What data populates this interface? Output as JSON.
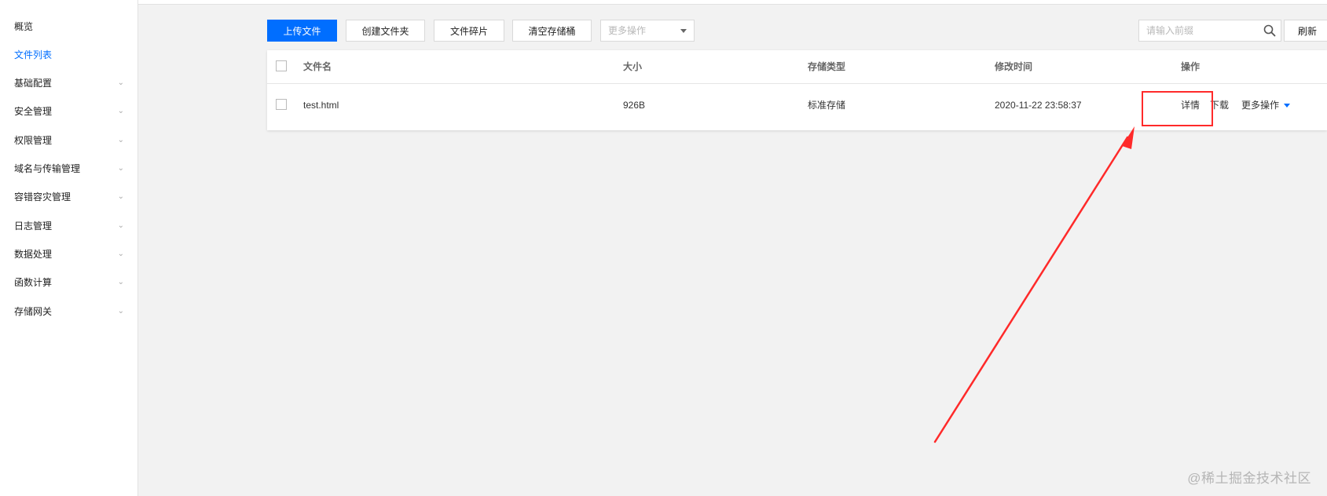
{
  "sidebar": {
    "items": [
      {
        "label": "概览",
        "active": false,
        "expandable": false
      },
      {
        "label": "文件列表",
        "active": true,
        "expandable": false
      },
      {
        "label": "基础配置",
        "active": false,
        "expandable": true
      },
      {
        "label": "安全管理",
        "active": false,
        "expandable": true
      },
      {
        "label": "权限管理",
        "active": false,
        "expandable": true
      },
      {
        "label": "域名与传输管理",
        "active": false,
        "expandable": true
      },
      {
        "label": "容错容灾管理",
        "active": false,
        "expandable": true
      },
      {
        "label": "日志管理",
        "active": false,
        "expandable": true
      },
      {
        "label": "数据处理",
        "active": false,
        "expandable": true
      },
      {
        "label": "函数计算",
        "active": false,
        "expandable": true
      },
      {
        "label": "存储网关",
        "active": false,
        "expandable": true
      }
    ],
    "chevron_glyph": "⌄"
  },
  "toolbar": {
    "upload_label": "上传文件",
    "create_folder_label": "创建文件夹",
    "fragments_label": "文件碎片",
    "clear_bucket_label": "清空存储桶",
    "more_actions_placeholder": "更多操作",
    "search_placeholder": "请输入前缀",
    "refresh_label": "刷新"
  },
  "table": {
    "headers": {
      "name": "文件名",
      "size": "大小",
      "storage_class": "存储类型",
      "modified": "修改时间",
      "actions": "操作"
    },
    "rows": [
      {
        "name": "test.html",
        "size": "926B",
        "storage_class": "标准存储",
        "modified": "2020-11-22 23:58:37",
        "action_detail": "详情",
        "action_download": "下载",
        "action_more": "更多操作"
      }
    ]
  },
  "watermark": "@稀土掘金技术社区",
  "colors": {
    "accent": "#006eff",
    "annotation": "#ff2a2a"
  }
}
